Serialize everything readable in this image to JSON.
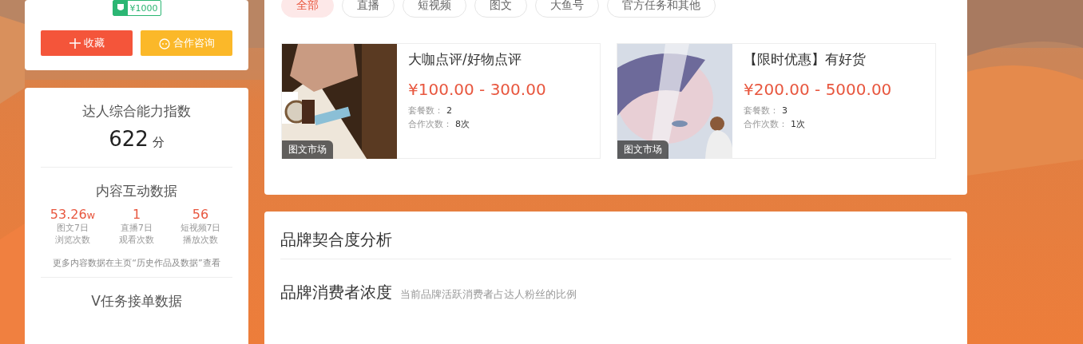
{
  "profile_card": {
    "price_badge": "¥1000",
    "buttons": [
      {
        "kind": "favorite",
        "label": "收藏"
      },
      {
        "kind": "consult",
        "label": "合作咨询"
      }
    ]
  },
  "ability_card": {
    "title": "达人综合能力指数",
    "score": "622",
    "score_unit": "分",
    "interaction_title": "内容互动数据",
    "stats": [
      {
        "value": "53.26",
        "unit": "w",
        "label_1": "图文7日",
        "label_2": "浏览次数"
      },
      {
        "value": "1",
        "label_1": "直播7日",
        "label_2": "观看次数"
      },
      {
        "value": "56",
        "label_1": "短视频7日",
        "label_2": "播放次数"
      }
    ],
    "note": "更多内容数据在主页“历史作品及数据”查看",
    "task_title": "V任务接单数据"
  },
  "tabs": [
    {
      "label": "全部",
      "selected": true
    },
    {
      "label": "直播",
      "selected": false
    },
    {
      "label": "短视频",
      "selected": false
    },
    {
      "label": "图文",
      "selected": false
    },
    {
      "label": "大鱼号",
      "selected": false
    },
    {
      "label": "官方任务和其他",
      "selected": false
    }
  ],
  "services": [
    {
      "tag": "图文市场",
      "title": "大咖点评/好物点评",
      "price": "¥100.00 - 300.00",
      "packages_label": "套餐数：",
      "packages": "2",
      "orders_label": "合作次数：",
      "orders": "8次"
    },
    {
      "tag": "图文市场",
      "title": "【限时优惠】有好货",
      "price": "¥200.00 - 5000.00",
      "packages_label": "套餐数：",
      "packages": "3",
      "orders_label": "合作次数：",
      "orders": "1次"
    }
  ],
  "brand_card": {
    "title": "品牌契合度分析",
    "subtitle": "品牌消费者浓度",
    "hint": "当前品牌活跃消费者占达人粉丝的比例"
  }
}
